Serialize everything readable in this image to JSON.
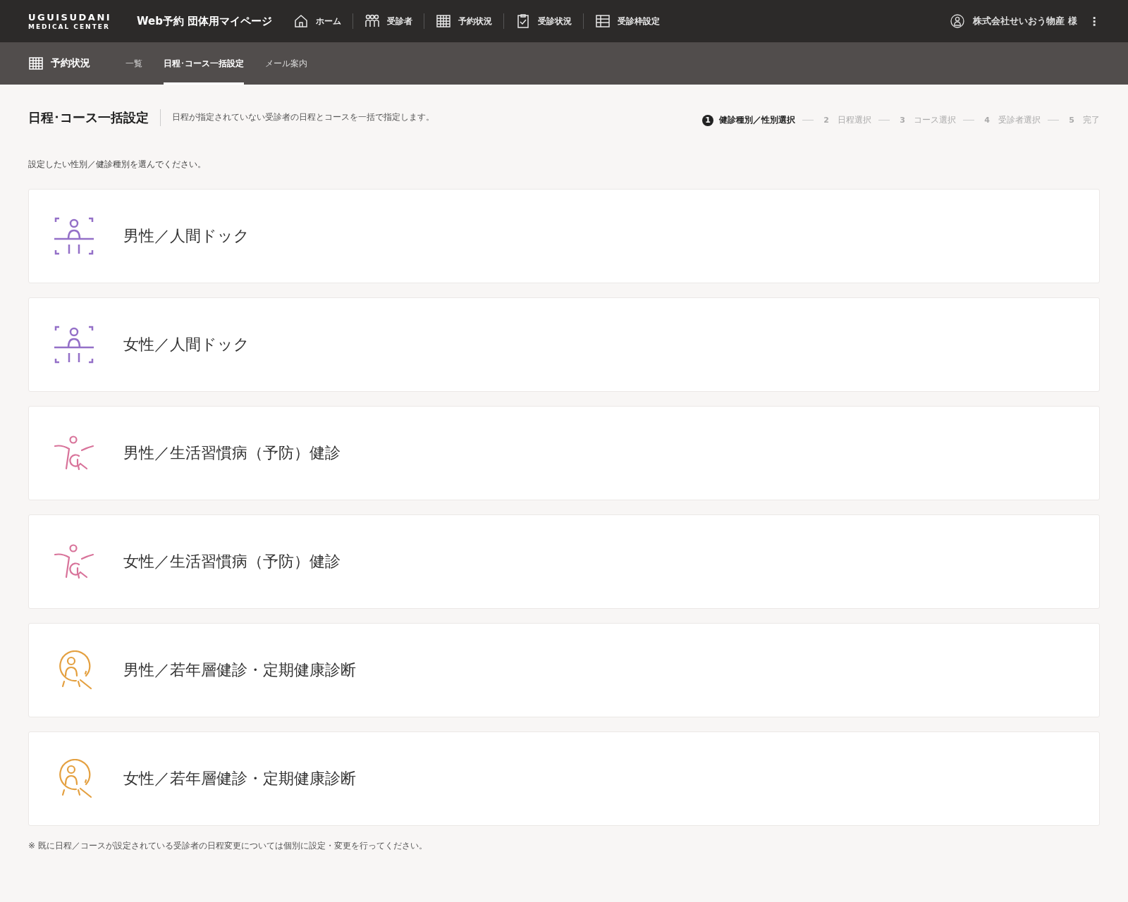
{
  "header": {
    "logo_line_1": "UGUISUDANI",
    "logo_line_2": "MEDICAL CENTER",
    "app_title": "Web予約 団体用マイページ",
    "nav": [
      {
        "kind": "home",
        "label": "ホーム"
      },
      {
        "kind": "people",
        "label": "受診者"
      },
      {
        "kind": "calendar",
        "label": "予約状況"
      },
      {
        "kind": "clipboard",
        "label": "受診状況"
      },
      {
        "kind": "table",
        "label": "受診枠設定"
      }
    ],
    "user": "株式会社せいおう物産 様",
    "more": "⋮"
  },
  "subnav": {
    "title": "予約状況",
    "tabs": [
      {
        "label": "一覧",
        "selected": false
      },
      {
        "label": "日程･コース一括設定",
        "selected": true
      },
      {
        "label": "メール案内",
        "selected": false
      }
    ]
  },
  "page": {
    "title": "日程･コース一括設定",
    "description": "日程が指定されていない受診者の日程とコースを一括で指定します。",
    "steps": [
      {
        "number": "1",
        "label": "健診種別／性別選択",
        "selected": true
      },
      {
        "number": "2",
        "label": "日程選択",
        "selected": false
      },
      {
        "number": "3",
        "label": "コース選択",
        "selected": false
      },
      {
        "number": "4",
        "label": "受診者選択",
        "selected": false
      },
      {
        "number": "5",
        "label": "完了",
        "selected": false
      }
    ],
    "instruction": "設定したい性別／健診種別を選んでください。",
    "options": [
      {
        "kind": "dock",
        "color": "#9470c8",
        "label": "男性／人間ドック"
      },
      {
        "kind": "dock",
        "color": "#9470c8",
        "label": "女性／人間ドック"
      },
      {
        "kind": "lifestyle",
        "color": "#d8739a",
        "label": "男性／生活習慣病（予防）健診"
      },
      {
        "kind": "lifestyle",
        "color": "#d8739a",
        "label": "女性／生活習慣病（予防）健診"
      },
      {
        "kind": "youth",
        "color": "#e4a040",
        "label": "男性／若年層健診・定期健康診断"
      },
      {
        "kind": "youth",
        "color": "#e4a040",
        "label": "女性／若年層健診・定期健康診断"
      }
    ],
    "note": "※ 既に日程／コースが設定されている受診者の日程変更については個別に設定・変更を行ってください。"
  }
}
